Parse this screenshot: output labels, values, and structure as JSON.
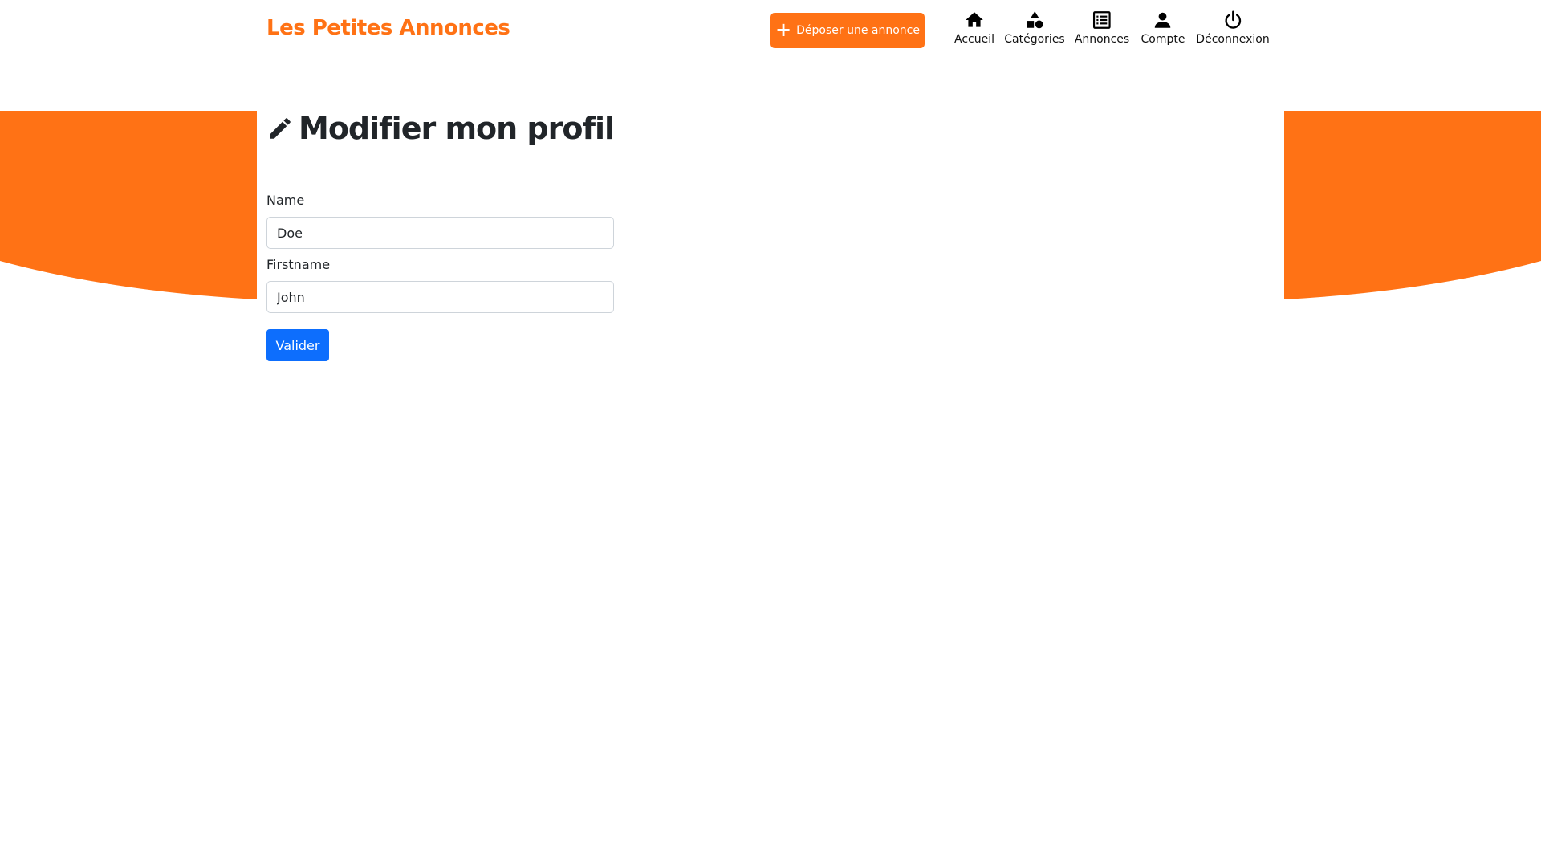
{
  "brand": {
    "name": "Les Petites Annonces"
  },
  "header": {
    "post_button": {
      "label": "Déposer une annonce",
      "icon": "plus-icon"
    },
    "nav": [
      {
        "label": "Accueil",
        "icon": "home-icon"
      },
      {
        "label": "Catégories",
        "icon": "shapes-icon"
      },
      {
        "label": "Annonces",
        "icon": "list-icon"
      },
      {
        "label": "Compte",
        "icon": "person-icon"
      },
      {
        "label": "Déconnexion",
        "icon": "power-icon"
      }
    ]
  },
  "page": {
    "title": "Modifier mon profil",
    "title_icon": "pencil-icon"
  },
  "form": {
    "name": {
      "label": "Name",
      "value": "Doe"
    },
    "firstname": {
      "label": "Firstname",
      "value": "John"
    },
    "submit_label": "Valider"
  },
  "colors": {
    "accent": "#FF7215",
    "primary_button": "#0D6EFD",
    "text": "#212529"
  }
}
